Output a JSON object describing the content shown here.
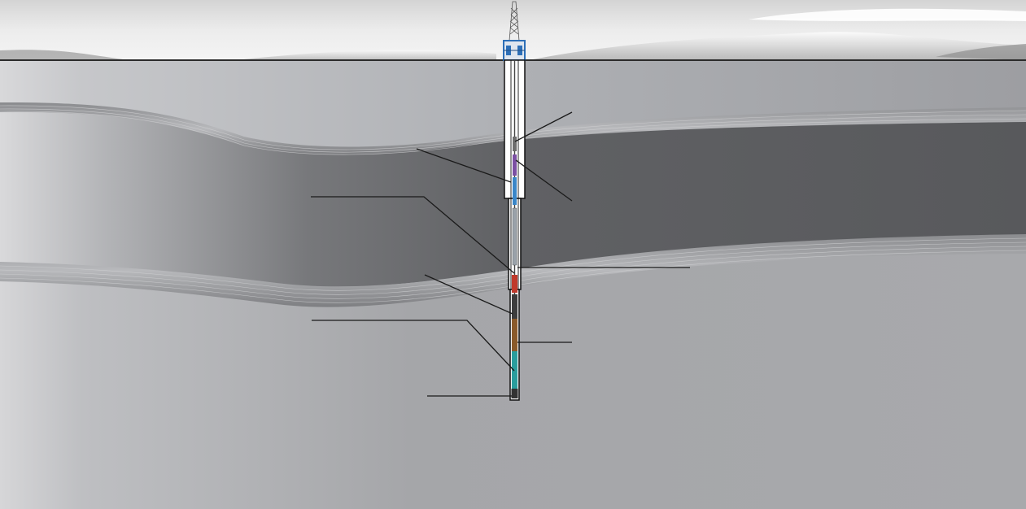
{
  "diagram": {
    "kind": "wellbore cross-section",
    "labels": [],
    "colors": {
      "sky_light": "#f1f1f1",
      "sky_shade": "#bcbcbc",
      "ground_surface_line": "#2b2b2b",
      "formation_upper": "#a9abb0",
      "formation_dark": "#5c5d60",
      "formation_lower": "#a7a8ab",
      "casing_wall": "#ffffff",
      "casing_outline": "#111111",
      "wellhead_blue": "#2d6fb7",
      "tool_blue": "#3a86c8",
      "tool_red": "#c0392b",
      "tool_brown": "#8a5a2b",
      "tool_teal": "#2a9d9d",
      "tool_purple": "#7b4fa3",
      "callout_line": "#1a1a1a"
    },
    "icons": [
      "derrick-icon",
      "wellhead-icon"
    ]
  }
}
